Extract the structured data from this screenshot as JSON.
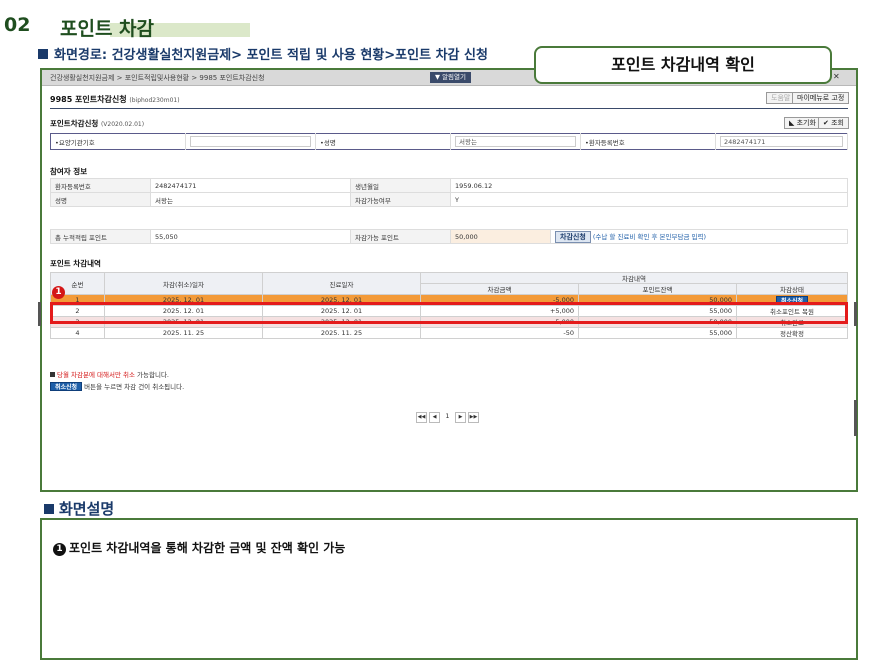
{
  "section": {
    "number": "02",
    "title": "포인트 차감"
  },
  "path": "화면경로: 건강생활실천지원금제> 포인트 적립 및 사용 현황>포인트 차감 신청",
  "callout": "포인트 차감내역 확인",
  "window": {
    "breadcrumb": "건강생활실천지원금제 > 포인트적립및사용현황 > 9985 포인트차감신청",
    "notice_button": "알림열기",
    "screen_title": "9985 포인트차감신청",
    "screen_code": "(biphod230m01)",
    "help_button": "도움말",
    "mymenu_button": "마이메뉴로 고정"
  },
  "search": {
    "title": "포인트차감신청",
    "title_code": "(V2020.02.01)",
    "reset_button": "초기화",
    "query_button": "조회",
    "institution_label": "•요양기관기호",
    "name_label": "•성명",
    "name_value": "서왕는",
    "patient_no_label": "•환자등록번호",
    "patient_no_value": "2482474171"
  },
  "participant": {
    "title": "참여자 정보",
    "rows": [
      {
        "label1": "환자등록번호",
        "value1": "2482474171",
        "label2": "생년월일",
        "value2": "1959.06.12"
      },
      {
        "label1": "성명",
        "value1": "서왕는",
        "label2": "차감가능여부",
        "value2": "Y"
      }
    ]
  },
  "points": {
    "total_label": "총 누적적립 포인트",
    "total_value": "55,050",
    "available_label": "차감가능 포인트",
    "available_value": "50,000",
    "deduct_button": "차감신청",
    "deduct_note": "(수납 할 진료비 확인 후 본인부담금 입력)"
  },
  "history": {
    "title": "포인트 차감내역",
    "headers": {
      "seq": "순번",
      "date": "차감(취소)일자",
      "visit": "진료일자",
      "group": "차감내역",
      "amount": "차감금액",
      "balance": "포인트잔액",
      "status": "차감상태"
    },
    "rows": [
      {
        "seq": "1",
        "date": "2025. 12. 01",
        "visit": "2025. 12. 01",
        "amount": "-5,000",
        "balance": "50,000",
        "status": "취소신청"
      },
      {
        "seq": "2",
        "date": "2025. 12. 01",
        "visit": "2025. 12. 01",
        "amount": "+5,000",
        "balance": "55,000",
        "status": "취소포인트 복원"
      },
      {
        "seq": "3",
        "date": "2025. 12. 01",
        "visit": "2025. 12. 01",
        "amount": "-5,000",
        "balance": "50,000",
        "status": "취소완료"
      },
      {
        "seq": "4",
        "date": "2025. 11. 25",
        "visit": "2025. 11. 25",
        "amount": "-50",
        "balance": "55,000",
        "status": "정산확정"
      }
    ],
    "note1_a": "당월 차감분에 대해서만 취소",
    "note1_b": " 가능합니다.",
    "note2_btn": "취소신청",
    "note2_text": " 버튼을 누르면 차감 건이 취소됩니다.",
    "pager": {
      "first": "◀◀",
      "prev": "◀",
      "current": "1",
      "next": "▶",
      "last": "▶▶"
    }
  },
  "marker": "1",
  "description": {
    "heading": "화면설명",
    "item_num": "1",
    "item_text": "포인트 차감내역을 통해 차감한 금액 및 잔액 확인 가능"
  },
  "colors": {
    "frame": "#4a7a3a",
    "selected_row": "#f39a38",
    "highlight": "#e41b1b",
    "button_blue": "#1f5fa8"
  }
}
